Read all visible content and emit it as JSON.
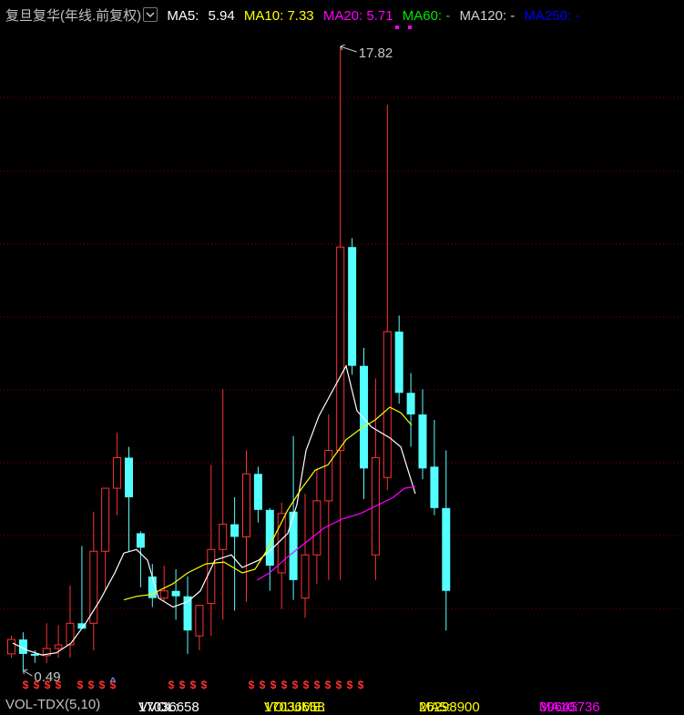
{
  "header": {
    "title": "复旦复华",
    "period": "(年线.前复权)",
    "menu_icon": "chevron-down-icon",
    "ma_items": [
      {
        "label": "MA5: ",
        "value": "5.94",
        "color": "#ffffff"
      },
      {
        "label": "MA10: ",
        "value": "7.33",
        "color": "#ffff00"
      },
      {
        "label": "MA20: ",
        "value": "5.71",
        "color": "#ff00ff"
      },
      {
        "label": "MA60: ",
        "value": "-",
        "color": "#00e600"
      },
      {
        "label": "MA120: ",
        "value": "-",
        "color": "#d0d0d0"
      },
      {
        "label": "MA250: ",
        "value": "-",
        "color": "#0000ff"
      }
    ]
  },
  "colors": {
    "up": "#ff3232",
    "down": "#54ffff",
    "ma5": "#ffffff",
    "ma10": "#ffff00",
    "ma20": "#ff00ff",
    "grid": "#8b0000",
    "marker": "#ff3232",
    "title_text": "#c0c0c0"
  },
  "chart_data": {
    "type": "candlestick",
    "title": "复旦复华 (年线.前复权)",
    "y_range": [
      0.29,
      18.2
    ],
    "grid": true,
    "annotations": {
      "high_label": "17.82",
      "low_label": "0.49"
    },
    "candles": [
      {
        "o": 0.95,
        "h": 1.45,
        "l": 0.85,
        "c": 1.35
      },
      {
        "o": 1.35,
        "h": 1.55,
        "l": 0.49,
        "c": 0.95
      },
      {
        "o": 0.95,
        "h": 1.05,
        "l": 0.7,
        "c": 0.9
      },
      {
        "o": 0.9,
        "h": 1.8,
        "l": 0.7,
        "c": 1.1
      },
      {
        "o": 1.1,
        "h": 1.75,
        "l": 0.85,
        "c": 1.2
      },
      {
        "o": 1.2,
        "h": 2.85,
        "l": 0.85,
        "c": 1.8
      },
      {
        "o": 1.8,
        "h": 3.95,
        "l": 1.7,
        "c": 1.65
      },
      {
        "o": 1.8,
        "h": 4.9,
        "l": 1.05,
        "c": 3.8
      },
      {
        "o": 3.8,
        "h": 4.9,
        "l": 2.7,
        "c": 5.55
      },
      {
        "o": 5.55,
        "h": 7.1,
        "l": 4.8,
        "c": 6.4
      },
      {
        "o": 6.4,
        "h": 6.7,
        "l": 3.8,
        "c": 5.3
      },
      {
        "o": 4.3,
        "h": 4.35,
        "l": 2.8,
        "c": 3.9
      },
      {
        "o": 3.1,
        "h": 3.45,
        "l": 2.25,
        "c": 2.5
      },
      {
        "o": 2.5,
        "h": 3.4,
        "l": 2.4,
        "c": 2.7
      },
      {
        "o": 2.7,
        "h": 3.3,
        "l": 1.9,
        "c": 2.55
      },
      {
        "o": 2.55,
        "h": 3.1,
        "l": 0.95,
        "c": 1.6
      },
      {
        "o": 1.45,
        "h": 2.3,
        "l": 1.05,
        "c": 2.3
      },
      {
        "o": 2.35,
        "h": 6.2,
        "l": 1.45,
        "c": 3.85
      },
      {
        "o": 3.85,
        "h": 8.3,
        "l": 1.9,
        "c": 4.55
      },
      {
        "o": 4.55,
        "h": 5.3,
        "l": 2.15,
        "c": 4.2
      },
      {
        "o": 4.2,
        "h": 6.6,
        "l": 2.4,
        "c": 5.95
      },
      {
        "o": 5.95,
        "h": 6.15,
        "l": 4.6,
        "c": 4.95
      },
      {
        "o": 4.95,
        "h": 5.0,
        "l": 2.7,
        "c": 3.4
      },
      {
        "o": 3.2,
        "h": 5.15,
        "l": 2.2,
        "c": 4.85
      },
      {
        "o": 4.9,
        "h": 7.0,
        "l": 2.45,
        "c": 3.0
      },
      {
        "o": 2.5,
        "h": 5.4,
        "l": 1.95,
        "c": 3.7
      },
      {
        "o": 3.7,
        "h": 6.1,
        "l": 2.9,
        "c": 5.2
      },
      {
        "o": 5.2,
        "h": 7.6,
        "l": 3.0,
        "c": 6.6
      },
      {
        "o": 6.6,
        "h": 17.82,
        "l": 3.0,
        "c": 12.25
      },
      {
        "o": 12.25,
        "h": 12.5,
        "l": 8.7,
        "c": 8.95
      },
      {
        "o": 8.95,
        "h": 9.45,
        "l": 5.25,
        "c": 6.1
      },
      {
        "o": 3.7,
        "h": 8.6,
        "l": 3.0,
        "c": 6.4
      },
      {
        "o": 5.85,
        "h": 16.2,
        "l": 5.5,
        "c": 9.9
      },
      {
        "o": 9.9,
        "h": 10.35,
        "l": 7.9,
        "c": 8.2
      },
      {
        "o": 8.2,
        "h": 8.75,
        "l": 6.7,
        "c": 7.6
      },
      {
        "o": 7.6,
        "h": 8.3,
        "l": 5.8,
        "c": 6.1
      },
      {
        "o": 6.15,
        "h": 7.45,
        "l": 4.8,
        "c": 5.0
      },
      {
        "o": 5.0,
        "h": 6.6,
        "l": 1.6,
        "c": 2.7
      }
    ],
    "ma5_points": [
      [
        14,
        1.25
      ],
      [
        30,
        1.05
      ],
      [
        46,
        0.92
      ],
      [
        62,
        0.98
      ],
      [
        78,
        1.25
      ],
      [
        94,
        1.8
      ],
      [
        110,
        2.45
      ],
      [
        126,
        3.2
      ],
      [
        136,
        3.75
      ],
      [
        150,
        3.85
      ],
      [
        162,
        3.55
      ],
      [
        174,
        2.5
      ],
      [
        190,
        2.25
      ],
      [
        206,
        2.4
      ],
      [
        220,
        2.7
      ],
      [
        236,
        3.55
      ],
      [
        254,
        3.7
      ],
      [
        266,
        3.35
      ],
      [
        284,
        3.55
      ],
      [
        300,
        3.9
      ],
      [
        316,
        4.3
      ],
      [
        326,
        5.1
      ],
      [
        336,
        6.6
      ],
      [
        350,
        7.55
      ],
      [
        366,
        8.3
      ],
      [
        380,
        8.95
      ],
      [
        392,
        7.7
      ],
      [
        408,
        7.25
      ],
      [
        428,
        6.95
      ],
      [
        440,
        6.7
      ],
      [
        456,
        5.4
      ]
    ],
    "ma10_points": [
      [
        136,
        2.45
      ],
      [
        150,
        2.55
      ],
      [
        166,
        2.6
      ],
      [
        190,
        2.9
      ],
      [
        206,
        3.2
      ],
      [
        226,
        3.45
      ],
      [
        246,
        3.5
      ],
      [
        266,
        3.2
      ],
      [
        280,
        3.3
      ],
      [
        296,
        3.95
      ],
      [
        316,
        4.95
      ],
      [
        330,
        5.5
      ],
      [
        346,
        6.05
      ],
      [
        360,
        6.2
      ],
      [
        380,
        6.9
      ],
      [
        396,
        7.2
      ],
      [
        412,
        7.45
      ],
      [
        428,
        7.8
      ],
      [
        440,
        7.65
      ],
      [
        452,
        7.3
      ]
    ],
    "ma20_points": [
      [
        282,
        3.0
      ],
      [
        296,
        3.2
      ],
      [
        316,
        3.65
      ],
      [
        336,
        4.05
      ],
      [
        356,
        4.45
      ],
      [
        376,
        4.7
      ],
      [
        396,
        4.85
      ],
      [
        416,
        5.1
      ],
      [
        432,
        5.3
      ],
      [
        444,
        5.55
      ],
      [
        456,
        5.6
      ]
    ],
    "markers": {
      "glyph": "$",
      "caret": "^",
      "caret_index": 7,
      "x": [
        28,
        40,
        52,
        64,
        88,
        100,
        112,
        124,
        188,
        200,
        212,
        224,
        276,
        288,
        300,
        312,
        324,
        336,
        348,
        360,
        372,
        384,
        396
      ]
    }
  },
  "footer": {
    "indicator": "VOL-TDX(5,10)",
    "items": [
      {
        "label": "VVOL: ",
        "value": "17036658",
        "color": "#ffffff"
      },
      {
        "label": "VOLUME: ",
        "value": "17036658",
        "color": "#ffff00"
      },
      {
        "label": "MA5: ",
        "value": "26298900",
        "color": "#ffff00"
      },
      {
        "label": "MA10: ",
        "value": "39645736",
        "color": "#ff00ff"
      }
    ]
  }
}
